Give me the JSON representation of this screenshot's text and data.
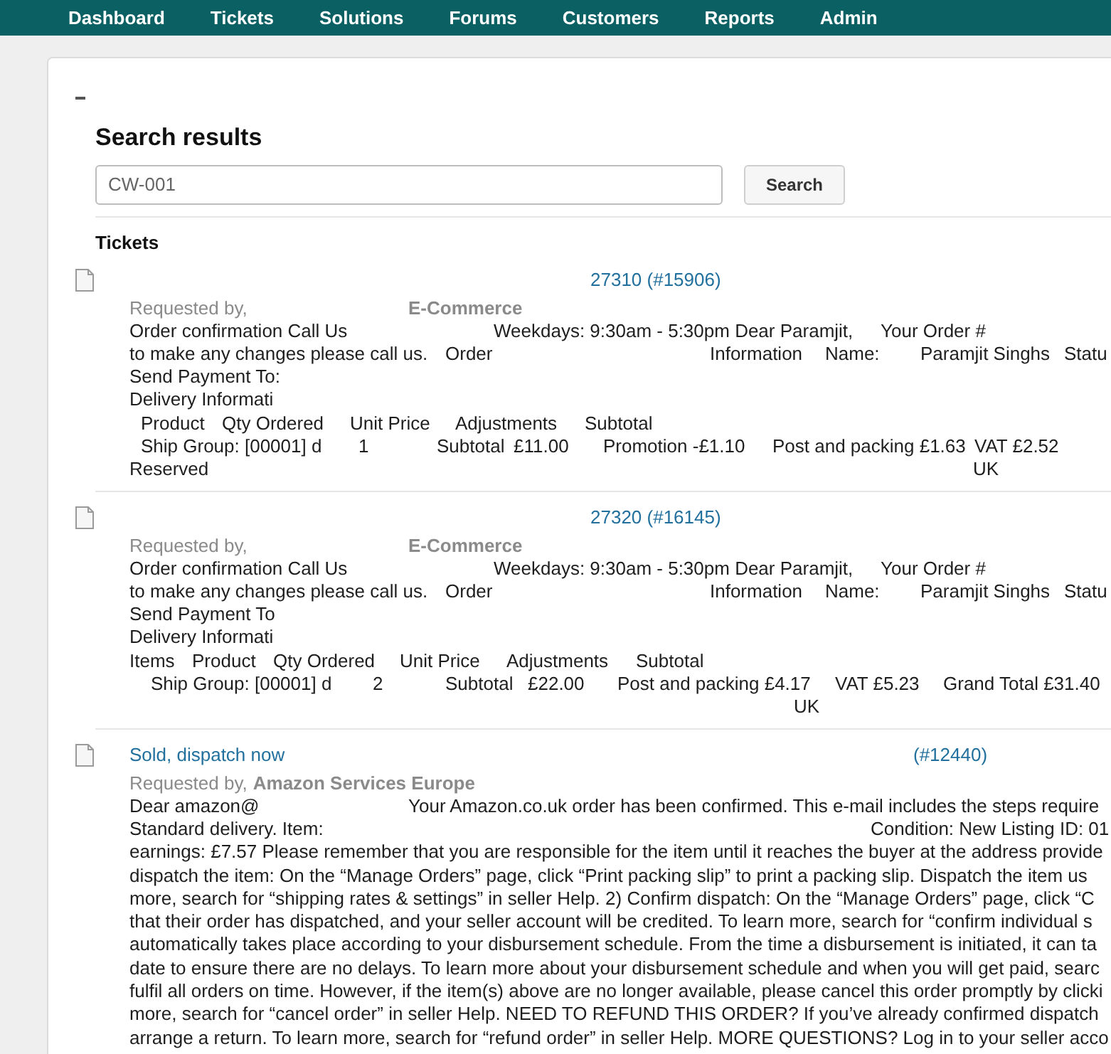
{
  "nav": [
    "Dashboard",
    "Tickets",
    "Solutions",
    "Forums",
    "Customers",
    "Reports",
    "Admin"
  ],
  "search": {
    "title": "Search results",
    "value": "CW-001",
    "button": "Search"
  },
  "tickets": {
    "heading": "Tickets",
    "items": [
      {
        "title": [
          "27310 (#15906)"
        ],
        "requester": {
          "label": "Requested by,",
          "name": "E-Commerce"
        },
        "lines": [
          [
            "Order confirmation Call Us",
            "Weekdays: 9:30am - 5:30pm Dear Paramjit,",
            "Your Order #"
          ],
          [
            "to make any changes please call us.",
            "Order",
            "Information",
            "Name:",
            "Paramjit Singhs",
            "Statu"
          ],
          [
            "Send Payment To:"
          ],
          [
            "Delivery Informati"
          ],
          [
            "Product",
            "Qty Ordered",
            "Unit Price",
            "Adjustments",
            "Subtotal"
          ],
          [
            "Ship Group: [00001] d",
            "1",
            "Subtotal",
            "£11.00",
            "Promotion -£1.10",
            "Post and packing £1.63",
            "VAT £2.52"
          ],
          [
            "Reserved",
            "UK"
          ]
        ]
      },
      {
        "title": [
          "27320 (#16145)"
        ],
        "requester": {
          "label": "Requested by,",
          "name": "E-Commerce"
        },
        "lines": [
          [
            "Order confirmation Call Us",
            "Weekdays: 9:30am - 5:30pm Dear Paramjit,",
            "Your Order #"
          ],
          [
            "to make any changes please call us.",
            "Order",
            "Information",
            "Name:",
            "Paramjit Singhs",
            "Statu"
          ],
          [
            "Send Payment To"
          ],
          [
            "Delivery Informati"
          ],
          [
            "Items",
            "Product",
            "Qty Ordered",
            "Unit Price",
            "Adjustments",
            "Subtotal"
          ],
          [
            "Ship Group: [00001] d",
            "2",
            "Subtotal",
            "£22.00",
            "Post and packing £4.17",
            "VAT £5.23",
            "Grand Total £31.40"
          ],
          [
            "UK"
          ]
        ]
      },
      {
        "title": [
          "Sold, dispatch now",
          "(#12440)"
        ],
        "requester": {
          "label": "Requested by,",
          "name": "Amazon Services Europe"
        },
        "lines": [
          [
            "Dear amazon@",
            "Your Amazon.co.uk order has been confirmed. This e-mail includes the steps require"
          ],
          [
            "Standard delivery. Item:",
            "Condition: New Listing ID: 01"
          ],
          [
            "earnings: £7.57 Please remember that you are responsible for the item until it reaches the buyer at the address provide"
          ],
          [
            "dispatch the item: On the “Manage Orders” page, click “Print packing slip” to print a packing slip. Dispatch the item us"
          ],
          [
            "more, search for “shipping rates & settings” in seller Help. 2) Confirm dispatch: On the “Manage Orders” page, click “C"
          ],
          [
            "that their order has dispatched, and your seller account will be credited. To learn more, search for “confirm individual s"
          ],
          [
            "automatically takes place according to your disbursement schedule. From the time a disbursement is initiated, it can ta"
          ],
          [
            "date to ensure there are no delays. To learn more about your disbursement schedule and when you will get paid, searc"
          ],
          [
            "fulfil all orders on time. However, if the item(s) above are no longer available, please cancel this order promptly by clicki"
          ],
          [
            "more, search for “cancel order” in seller Help. NEED TO REFUND THIS ORDER? If you’ve already confirmed dispatch"
          ],
          [
            "arrange a return. To learn more, search for “refund order” in seller Help. MORE QUESTIONS? Log in to your seller acco"
          ]
        ]
      }
    ]
  }
}
